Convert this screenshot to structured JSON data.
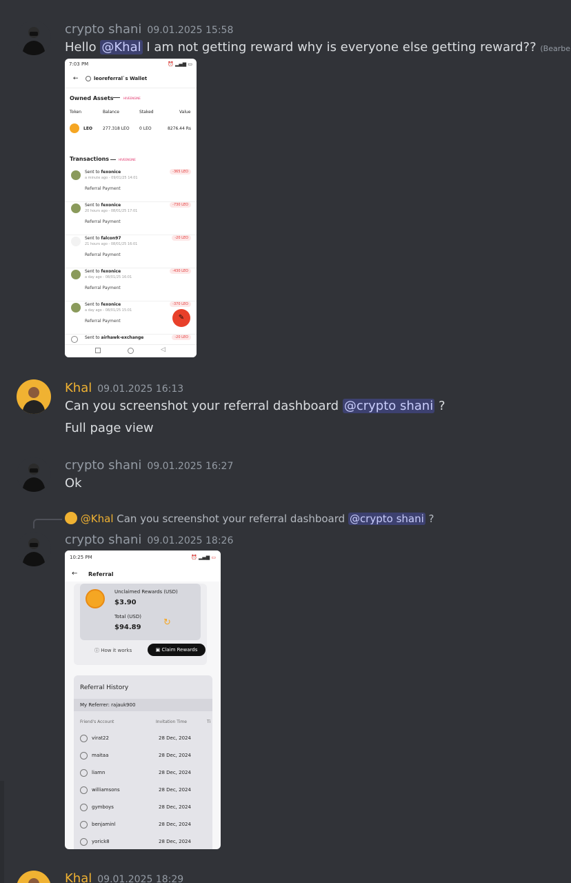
{
  "messages": [
    {
      "author": "crypto shani",
      "author_color": "#949ba4",
      "time": "09.01.2025 15:58",
      "text_before": "Hello ",
      "mention": "@Khal",
      "text_after": " I am not getting reward why is everyone else getting reward??",
      "edited": "(Bearbeitet)"
    },
    {
      "author": "Khal",
      "author_color": "#f0b232",
      "time": "09.01.2025 16:13",
      "text_before": "Can you screenshot your referral dashboard ",
      "mention": "@crypto shani",
      "text_after": " ?",
      "second_line": "Full page view"
    },
    {
      "author": "crypto shani",
      "author_color": "#949ba4",
      "time": "09.01.2025 16:27",
      "text": "Ok"
    },
    {
      "reply": {
        "mention": "@Khal",
        "text_before": "Can you screenshot your referral dashboard ",
        "text_mention": "@crypto shani",
        "text_after": " ?"
      },
      "author": "crypto shani",
      "author_color": "#949ba4",
      "time": "09.01.2025 18:26"
    },
    {
      "author": "Khal",
      "author_color": "#f0b232",
      "time": "09.01.2025 18:29"
    }
  ],
  "wallet_shot": {
    "status_time": "7:03 PM",
    "title": "leoreferral`s Wallet",
    "owned_assets": "Owned Assets",
    "brand": "HIVEENGINE",
    "cols": [
      "Token",
      "Balance",
      "Staked",
      "Value"
    ],
    "asset": {
      "token": "LEO",
      "balance": "277.318 LEO",
      "staked": "0 LEO",
      "value": "8276.44 Rs"
    },
    "transactions": "Transactions",
    "tx": [
      {
        "to_label": "Sent to",
        "to": "fexonice",
        "when": "a minute ago - 09/01/25 14:01",
        "memo": "Referral Payment",
        "amount": "-365",
        "unit": "LEO"
      },
      {
        "to_label": "Sent to",
        "to": "fexonice",
        "when": "20 hours ago - 08/01/25 17:01",
        "memo": "Referral Payment",
        "amount": "-730",
        "unit": "LEO"
      },
      {
        "to_label": "Sent to",
        "to": "falcon97",
        "when": "21 hours ago - 08/01/25 16:01",
        "memo": "Referral Payment",
        "amount": "-20",
        "unit": "LEO"
      },
      {
        "to_label": "Sent to",
        "to": "fexonice",
        "when": "a day ago - 08/01/25 16:01",
        "memo": "Referral Payment",
        "amount": "-430",
        "unit": "LEO"
      },
      {
        "to_label": "Sent to",
        "to": "fexonice",
        "when": "a day ago - 08/01/25 15:01",
        "memo": "Referral Payment",
        "amount": "-370",
        "unit": "LEO"
      },
      {
        "to_label": "Sent to",
        "to": "airhawk-exchange",
        "when": "",
        "memo": "",
        "amount": "-20",
        "unit": "LEO"
      }
    ]
  },
  "referral_shot": {
    "status_time": "10:25 PM",
    "title": "Referral",
    "unclaimed_label": "Unclaimed Rewards (USD)",
    "unclaimed_value": "$3.90",
    "total_label": "Total (USD)",
    "total_value": "$94.89",
    "how_it_works": "How it works",
    "claim": "Claim Rewards",
    "history_title": "Referral History",
    "my_referrer": "My Referrer: rajauk900",
    "col_account": "Friend's Account",
    "col_time": "Invitation Time",
    "col_extra": "Ti",
    "rows": [
      {
        "name": "virat22",
        "date": "28 Dec, 2024"
      },
      {
        "name": "maitaa",
        "date": "28 Dec, 2024"
      },
      {
        "name": "liamn",
        "date": "28 Dec, 2024"
      },
      {
        "name": "williamsons",
        "date": "28 Dec, 2024"
      },
      {
        "name": "gymboys",
        "date": "28 Dec, 2024"
      },
      {
        "name": "benjaminl",
        "date": "28 Dec, 2024"
      },
      {
        "name": "yorick8",
        "date": "28 Dec, 2024"
      }
    ]
  }
}
